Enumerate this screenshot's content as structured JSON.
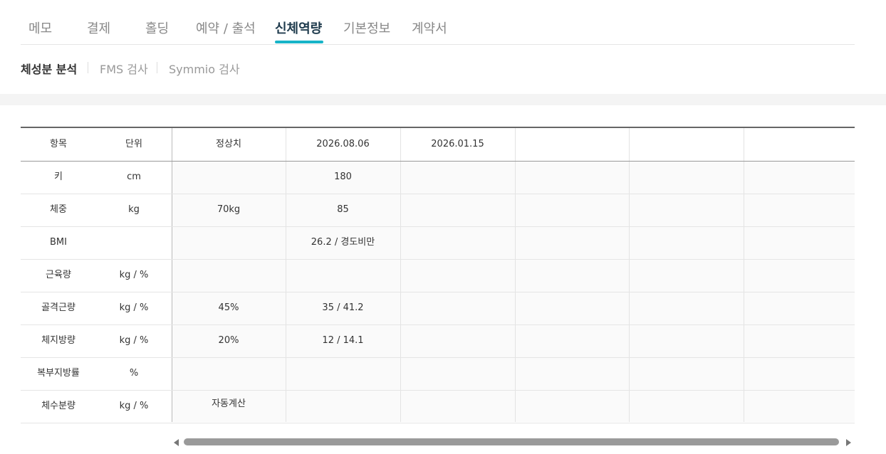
{
  "tabs": [
    {
      "label": "메모"
    },
    {
      "label": "결제"
    },
    {
      "label": "홀딩"
    },
    {
      "label": "예약 / 출석"
    },
    {
      "label": "신체역량"
    },
    {
      "label": "기본정보"
    },
    {
      "label": "계약서"
    }
  ],
  "active_tab": "신체역량",
  "subtabs": [
    {
      "label": "체성분 분석"
    },
    {
      "label": "FMS 검사"
    },
    {
      "label": "Symmio 검사"
    }
  ],
  "active_subtab": "체성분 분석",
  "table": {
    "headers": [
      "항목",
      "단위",
      "정상치",
      "2026.08.06",
      "2026.01.15",
      "",
      "",
      ""
    ],
    "rows": [
      [
        "키",
        "cm",
        "",
        "180",
        "",
        "",
        "",
        ""
      ],
      [
        "체중",
        "kg",
        "70kg",
        "85",
        "",
        "",
        "",
        ""
      ],
      [
        "BMI",
        "",
        "",
        "26.2 / 경도비만",
        "",
        "",
        "",
        ""
      ],
      [
        "근육량",
        "kg / %",
        "",
        "",
        "",
        "",
        "",
        ""
      ],
      [
        "골격근량",
        "kg / %",
        "45%",
        "35 / 41.2",
        "",
        "",
        "",
        ""
      ],
      [
        "체지방량",
        "kg / %",
        "20%",
        "12 / 14.1",
        "",
        "",
        "",
        ""
      ],
      [
        "복부지방률",
        "%",
        "",
        "",
        "",
        "",
        "",
        ""
      ],
      [
        "체수분량",
        "kg / %",
        "자동계산",
        "",
        "",
        "",
        "",
        ""
      ]
    ]
  },
  "colors": {
    "accent": "#18b4c8",
    "active_text": "#1f3b4d",
    "muted_text": "#888888"
  }
}
